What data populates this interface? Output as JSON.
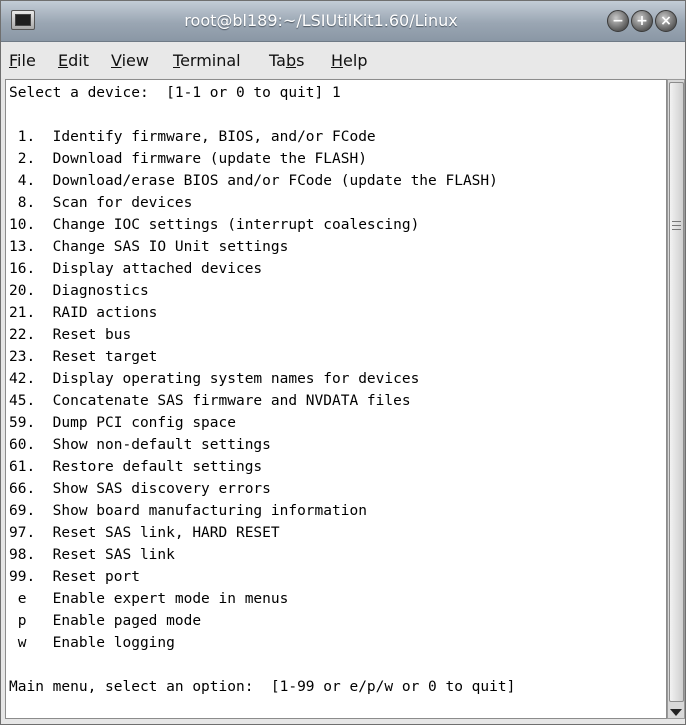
{
  "window": {
    "title": "root@bl189:~/LSIUtilKit1.60/Linux"
  },
  "menubar": {
    "items": [
      {
        "pre": "",
        "acc": "F",
        "post": "ile"
      },
      {
        "pre": "",
        "acc": "E",
        "post": "dit"
      },
      {
        "pre": "",
        "acc": "V",
        "post": "iew"
      },
      {
        "pre": "",
        "acc": "T",
        "post": "erminal"
      },
      {
        "pre": "Ta",
        "acc": "b",
        "post": "s"
      },
      {
        "pre": "",
        "acc": "H",
        "post": "elp"
      }
    ]
  },
  "window_controls": {
    "minimize_glyph": "−",
    "maximize_glyph": "+",
    "close_glyph": "×"
  },
  "terminal": {
    "lines": [
      "Select a device:  [1-1 or 0 to quit] 1",
      "",
      " 1.  Identify firmware, BIOS, and/or FCode",
      " 2.  Download firmware (update the FLASH)",
      " 4.  Download/erase BIOS and/or FCode (update the FLASH)",
      " 8.  Scan for devices",
      "10.  Change IOC settings (interrupt coalescing)",
      "13.  Change SAS IO Unit settings",
      "16.  Display attached devices",
      "20.  Diagnostics",
      "21.  RAID actions",
      "22.  Reset bus",
      "23.  Reset target",
      "42.  Display operating system names for devices",
      "45.  Concatenate SAS firmware and NVDATA files",
      "59.  Dump PCI config space",
      "60.  Show non-default settings",
      "61.  Restore default settings",
      "66.  Show SAS discovery errors",
      "69.  Show board manufacturing information",
      "97.  Reset SAS link, HARD RESET",
      "98.  Reset SAS link",
      "99.  Reset port",
      " e   Enable expert mode in menus",
      " p   Enable paged mode",
      " w   Enable logging",
      "",
      "Main menu, select an option:  [1-99 or e/p/w or 0 to quit]"
    ]
  }
}
